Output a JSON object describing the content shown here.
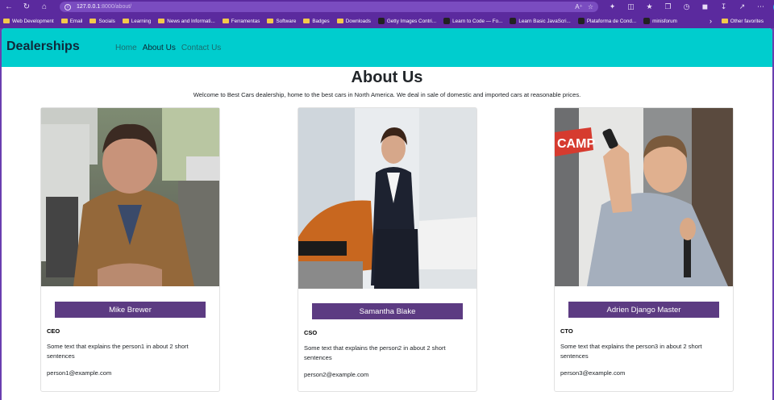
{
  "browser": {
    "url_host": "127.0.0.1",
    "url_rest": ":8000/about/",
    "bookmarks": [
      {
        "label": "Web Development",
        "kind": "folder"
      },
      {
        "label": "Email",
        "kind": "folder"
      },
      {
        "label": "Socials",
        "kind": "folder"
      },
      {
        "label": "Learning",
        "kind": "folder"
      },
      {
        "label": "News and Informati...",
        "kind": "folder"
      },
      {
        "label": "Ferramentas",
        "kind": "folder"
      },
      {
        "label": "Software",
        "kind": "folder"
      },
      {
        "label": "Badges",
        "kind": "folder"
      },
      {
        "label": "Downloads",
        "kind": "folder"
      },
      {
        "label": "Getty Images Contri...",
        "kind": "site"
      },
      {
        "label": "Learn to Code — Fo...",
        "kind": "site"
      },
      {
        "label": "Learn Basic JavaScri...",
        "kind": "site"
      },
      {
        "label": "Plataforma de Cond...",
        "kind": "site"
      },
      {
        "label": "minisforum",
        "kind": "site"
      }
    ],
    "other_favorites": "Other favorites"
  },
  "navbar": {
    "brand": "Dealerships",
    "links": [
      "Home",
      "About Us",
      "Contact Us"
    ],
    "active_link": "About Us",
    "color": "#00cdce"
  },
  "page": {
    "title": "About Us",
    "intro": "Welcome to Best Cars dealership, home to the best cars in North America. We deal in sale of domestic and imported cars at reasonable prices."
  },
  "team": [
    {
      "name": "Mike Brewer",
      "role": "CEO",
      "description": "Some text that explains the person1 in about 2 short sentences",
      "email": "person1@example.com"
    },
    {
      "name": "Samantha Blake",
      "role": "CSO",
      "description": "Some text that explains the person2 in about 2 short sentences",
      "email": "person2@example.com"
    },
    {
      "name": "Adrien Django Master",
      "role": "CTO",
      "description": "Some text that explains the person3 in about 2 short sentences",
      "email": "person3@example.com"
    }
  ],
  "colors": {
    "chrome": "#5b2a9e",
    "name_bar": "#5c3b82"
  }
}
